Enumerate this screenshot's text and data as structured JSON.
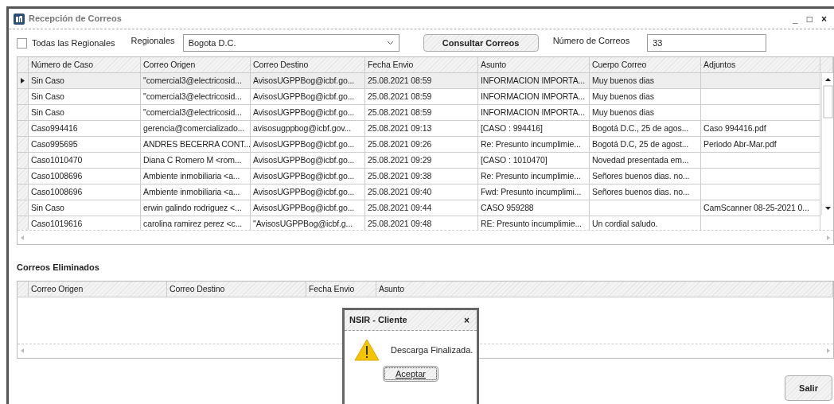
{
  "window": {
    "title": "Recepción de Correos",
    "controls": [
      "_",
      "□",
      "×"
    ]
  },
  "filters": {
    "all_regions": {
      "label": "Todas las Regionales",
      "checked": false
    },
    "region_label": "Regionales",
    "region_value": "Bogota D.C.",
    "query_button": "Consultar Correos",
    "count_label": "Número de Correos",
    "count_value": "33"
  },
  "table": {
    "columns": [
      "Número de Caso",
      "Correo Origen",
      "Correo Destino",
      "Fecha Envio",
      "Asunto",
      "Cuerpo Correo",
      "Adjuntos"
    ],
    "rows": [
      {
        "selected": true,
        "cells": [
          "Sin Caso",
          "\"comercial3@electricosid...",
          "AvisosUGPPBog@icbf.go...",
          "25.08.2021 08:59",
          "INFORMACION IMPORTA...",
          "Muy buenos dias",
          ""
        ]
      },
      {
        "selected": false,
        "cells": [
          "Sin Caso",
          "\"comercial3@electricosid...",
          "AvisosUGPPBog@icbf.go...",
          "25.08.2021 08:59",
          "INFORMACION IMPORTA...",
          "Muy buenos dias",
          ""
        ]
      },
      {
        "selected": false,
        "cells": [
          "Sin Caso",
          "\"comercial3@electricosid...",
          "AvisosUGPPBog@icbf.go...",
          "25.08.2021 08:59",
          "INFORMACION IMPORTA...",
          "Muy buenos dias",
          ""
        ]
      },
      {
        "selected": false,
        "cells": [
          "Caso994416",
          "gerencia@comercializado...",
          "avisosugppbog@icbf.gov...",
          "25.08.2021 09:13",
          "[CASO : 994416]",
          "Bogotá D.C., 25 de agos...",
          "Caso 994416.pdf"
        ]
      },
      {
        "selected": false,
        "cells": [
          "Caso995695",
          "ANDRES BECERRA CONT...",
          "AvisosUGPPBog@icbf.go...",
          "25.08.2021 09:26",
          "Re: Presunto incumplimie...",
          "Bogotá D.C, 25 de agost...",
          "Periodo Abr-Mar.pdf"
        ]
      },
      {
        "selected": false,
        "cells": [
          "Caso1010470",
          "Diana C Romero M <rom...",
          "AvisosUGPPBog@icbf.go...",
          "25.08.2021 09:29",
          "[CASO : 1010470]",
          "Novedad presentada em...",
          ""
        ]
      },
      {
        "selected": false,
        "cells": [
          "Caso1008696",
          "Ambiente inmobiliaria <a...",
          "AvisosUGPPBog@icbf.go...",
          "25.08.2021 09:38",
          "Re: Presunto incumplimie...",
          "Señores buenos dias. no...",
          ""
        ]
      },
      {
        "selected": false,
        "cells": [
          "Caso1008696",
          "Ambiente inmobiliaria <a...",
          "AvisosUGPPBog@icbf.go...",
          "25.08.2021 09:40",
          "Fwd: Presunto incumplimi...",
          "Señores buenos dias. no...",
          ""
        ]
      },
      {
        "selected": false,
        "cells": [
          "Sin Caso",
          "erwin galindo rodriguez <...",
          "AvisosUGPPBog@icbf.go...",
          "25.08.2021 09:44",
          "CASO 959288",
          "",
          "CamScanner 08-25-2021 0..."
        ]
      },
      {
        "selected": false,
        "cells": [
          "Caso1019616",
          "carolina ramirez perez <c...",
          "\"AvisosUGPPBog@icbf.g...",
          "25.08.2021 09:48",
          "RE: Presunto incumplimie...",
          "Un cordial saludo.",
          ""
        ]
      }
    ]
  },
  "deleted": {
    "title": "Correos Eliminados",
    "columns": [
      "Correo Origen",
      "Correo Destino",
      "Fecha Envio",
      "Asunto"
    ]
  },
  "exit_button": "Salir",
  "dialog": {
    "title": "NSIR - Cliente",
    "close": "×",
    "message": "Descarga Finalizada.",
    "button": "Aceptar"
  }
}
